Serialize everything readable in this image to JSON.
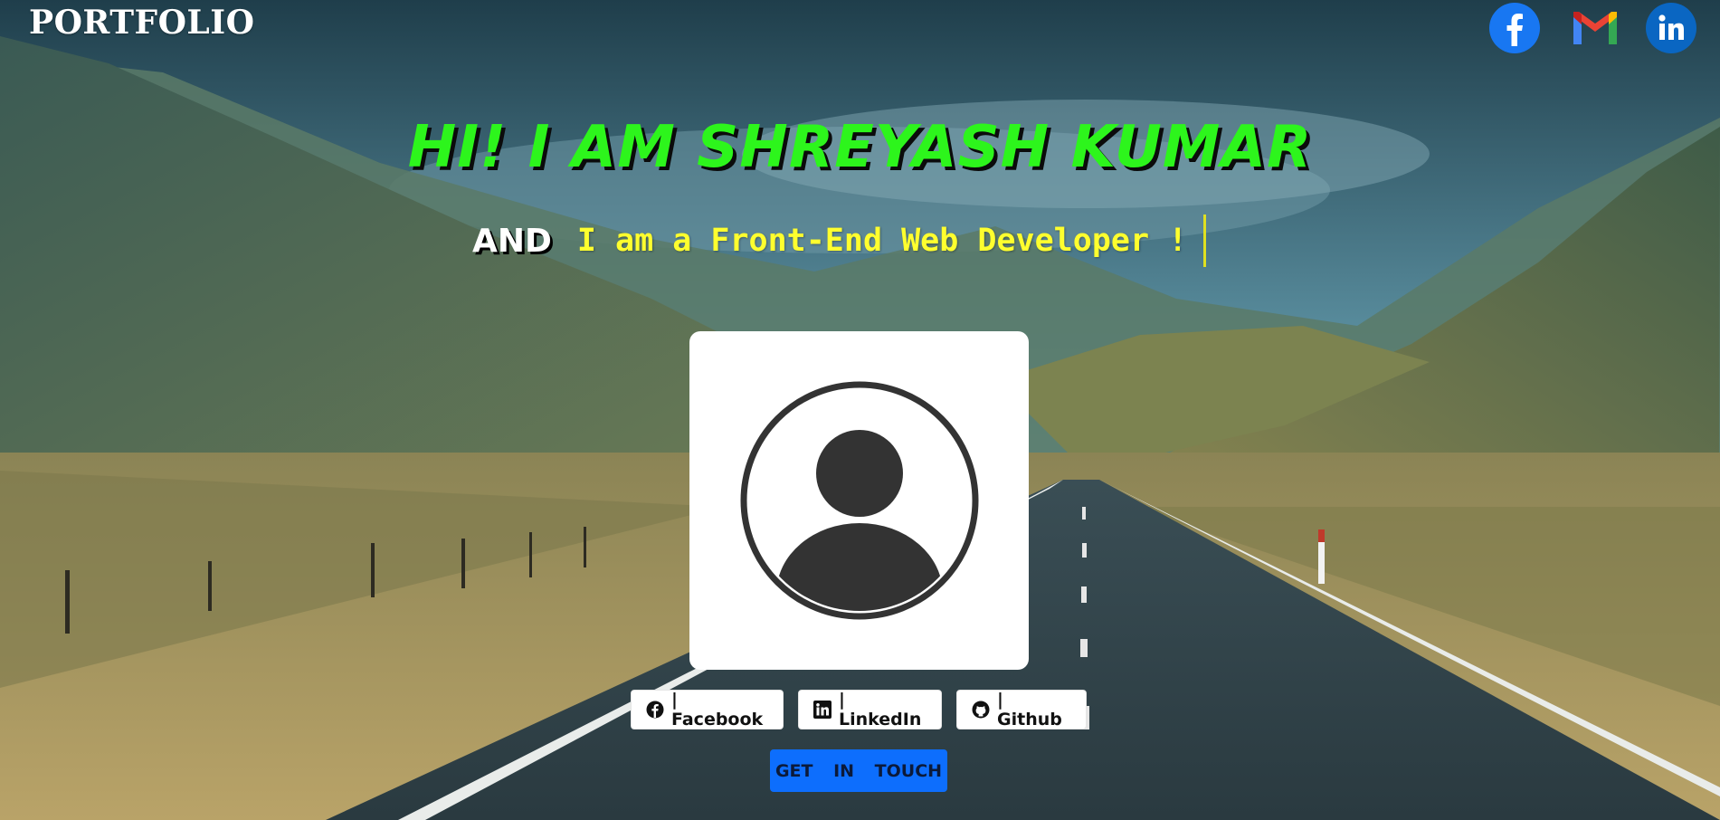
{
  "header": {
    "brand": "PORTFOLIO",
    "social_icons": [
      "facebook-icon",
      "gmail-icon",
      "linkedin-icon"
    ]
  },
  "hero": {
    "title": "HI! I AM SHREYASH KUMAR",
    "and_label": "AND",
    "typed_text": "I am a Front-End Web Developer !"
  },
  "profile": {
    "avatar_icon": "user-avatar-icon"
  },
  "links": [
    {
      "icon": "facebook-icon",
      "label": "| Facebook"
    },
    {
      "icon": "linkedin-icon",
      "label": "| LinkedIn"
    },
    {
      "icon": "github-icon",
      "label": "| Github"
    }
  ],
  "cta": {
    "label": "GET IN TOUCH",
    "color": "#0d6efd"
  },
  "colors": {
    "title": "#2df51c",
    "typed": "#ffff2e",
    "card": "#ffffff"
  }
}
